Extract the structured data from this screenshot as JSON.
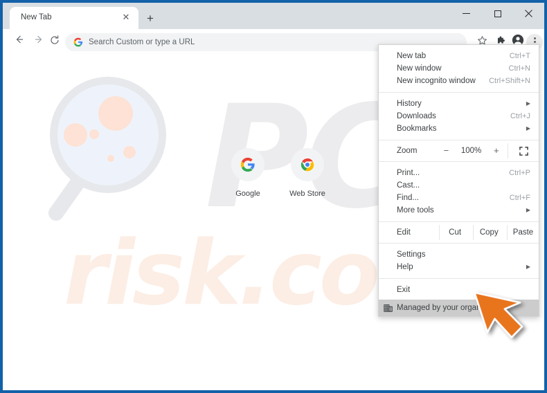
{
  "window": {
    "controls": {
      "minimize": "minimize-button",
      "maximize": "maximize-button",
      "close": "close-button"
    },
    "border_color": "#1361a8"
  },
  "tabbar": {
    "active_tab_title": "New Tab",
    "close_tab_label": "✕",
    "new_tab_label": "+",
    "background": "#d9dee3"
  },
  "toolbar": {
    "back_label": "←",
    "forward_label": "→",
    "reload_label": "⟳",
    "omnibox_placeholder": "Search Custom or type a URL",
    "star_label": "☆",
    "extensions_label": "puzzle-piece",
    "profile_label": "avatar",
    "menu_label": "three-dot"
  },
  "newtab": {
    "watermark_primary": "PC",
    "watermark_secondary": "risk.com",
    "watermark_primary_color": "#ececee",
    "watermark_secondary_color": "#fceee5",
    "shortcuts": [
      {
        "label": "Google",
        "icon": "google-logo"
      },
      {
        "label": "Web Store",
        "icon": "chrome-logo"
      }
    ]
  },
  "menu": {
    "groups": [
      {
        "items": [
          {
            "label": "New tab",
            "shortcut": "Ctrl+T",
            "submenu": false
          },
          {
            "label": "New window",
            "shortcut": "Ctrl+N",
            "submenu": false
          },
          {
            "label": "New incognito window",
            "shortcut": "Ctrl+Shift+N",
            "submenu": false
          }
        ]
      },
      {
        "items": [
          {
            "label": "History",
            "shortcut": "",
            "submenu": true
          },
          {
            "label": "Downloads",
            "shortcut": "Ctrl+J",
            "submenu": false
          },
          {
            "label": "Bookmarks",
            "shortcut": "",
            "submenu": true
          }
        ]
      }
    ],
    "zoom": {
      "label": "Zoom",
      "minus": "−",
      "value": "100%",
      "plus": "+",
      "fullscreen": "fullscreen-icon"
    },
    "tools_group": {
      "items": [
        {
          "label": "Print...",
          "shortcut": "Ctrl+P",
          "submenu": false
        },
        {
          "label": "Cast...",
          "shortcut": "",
          "submenu": false
        },
        {
          "label": "Find...",
          "shortcut": "Ctrl+F",
          "submenu": false
        },
        {
          "label": "More tools",
          "shortcut": "",
          "submenu": true
        }
      ]
    },
    "edit": {
      "label": "Edit",
      "cut": "Cut",
      "copy": "Copy",
      "paste": "Paste"
    },
    "settings_group": {
      "items": [
        {
          "label": "Settings",
          "shortcut": "",
          "submenu": false
        },
        {
          "label": "Help",
          "shortcut": "",
          "submenu": true
        }
      ]
    },
    "exit_group": {
      "items": [
        {
          "label": "Exit",
          "shortcut": "",
          "submenu": false
        }
      ]
    },
    "managed": {
      "label": "Managed by your organization",
      "icon": "organization-building-icon",
      "highlight_color": "#cccccc"
    }
  },
  "cursor": {
    "icon": "arrow-pointer",
    "color": "#e8751a"
  }
}
